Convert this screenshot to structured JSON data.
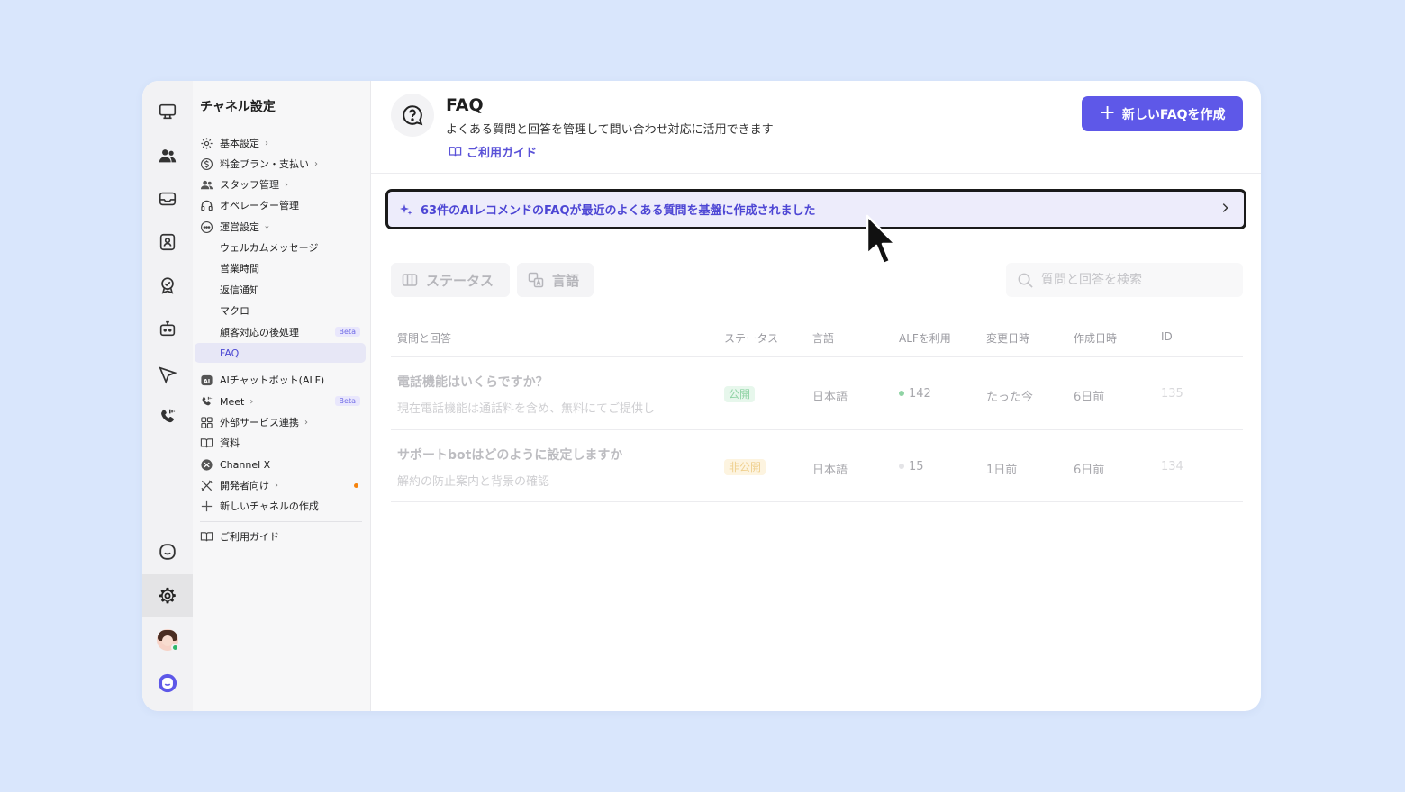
{
  "sidebar": {
    "title": "チャネル設定",
    "items": [
      {
        "label": "基本設定",
        "icon": "gear-icon"
      },
      {
        "label": "料金プラン・支払い",
        "icon": "dollar-icon"
      },
      {
        "label": "スタッフ管理",
        "icon": "staff-icon"
      },
      {
        "label": "オペレーター管理",
        "icon": "headset-icon"
      },
      {
        "label": "運営設定",
        "icon": "chat-dots-icon"
      },
      {
        "label": "ウェルカムメッセージ"
      },
      {
        "label": "営業時間"
      },
      {
        "label": "返信通知"
      },
      {
        "label": "マクロ"
      },
      {
        "label": "顧客対応の後処理",
        "badge": "Beta"
      },
      {
        "label": "FAQ"
      },
      {
        "label": "AIチャットボット(ALF)",
        "icon": "ai-icon"
      },
      {
        "label": "Meet",
        "icon": "phone-icon",
        "badge": "Beta"
      },
      {
        "label": "外部サービス連携",
        "icon": "grid-icon"
      },
      {
        "label": "資料",
        "icon": "book-icon"
      },
      {
        "label": "Channel X",
        "icon": "channelx-icon"
      },
      {
        "label": "開発者向け",
        "icon": "tools-icon"
      },
      {
        "label": "新しいチャネルの作成",
        "icon": "plus-icon"
      },
      {
        "label": "ご利用ガイド",
        "icon": "book-icon"
      }
    ]
  },
  "header": {
    "title": "FAQ",
    "description": "よくある質問と回答を管理して問い合わせ対応に活用できます",
    "guide_link": "ご利用ガイド",
    "new_button": "新しいFAQを作成"
  },
  "banner": {
    "text": "63件のAIレコメンドのFAQが最近のよくある質問を基盤に作成されました"
  },
  "filters": {
    "status": "ステータス",
    "language": "言語"
  },
  "search": {
    "placeholder": "質問と回答を検索"
  },
  "table": {
    "columns": [
      "質問と回答",
      "ステータス",
      "言語",
      "ALFを利用",
      "変更日時",
      "作成日時",
      "ID"
    ],
    "rows": [
      {
        "question": "電話機能はいくらですか？",
        "answer": "現在電話機能は通話料を含め、無料にてご提供し",
        "status": "公開",
        "language": "日本語",
        "alf": "142",
        "updated": "たった今",
        "created": "6日前",
        "id": "135"
      },
      {
        "question": "サポートbotはどのように設定しますか",
        "answer": "解約の防止案内と背景の確認",
        "status": "非公開",
        "language": "日本語",
        "alf": "15",
        "updated": "1日前",
        "created": "6日前",
        "id": "134"
      }
    ]
  },
  "colors": {
    "accent": "#5e58e8",
    "banner_bg": "#edecfb",
    "public_green": "#8fd3a4",
    "private_orange": "#efcf8d"
  }
}
